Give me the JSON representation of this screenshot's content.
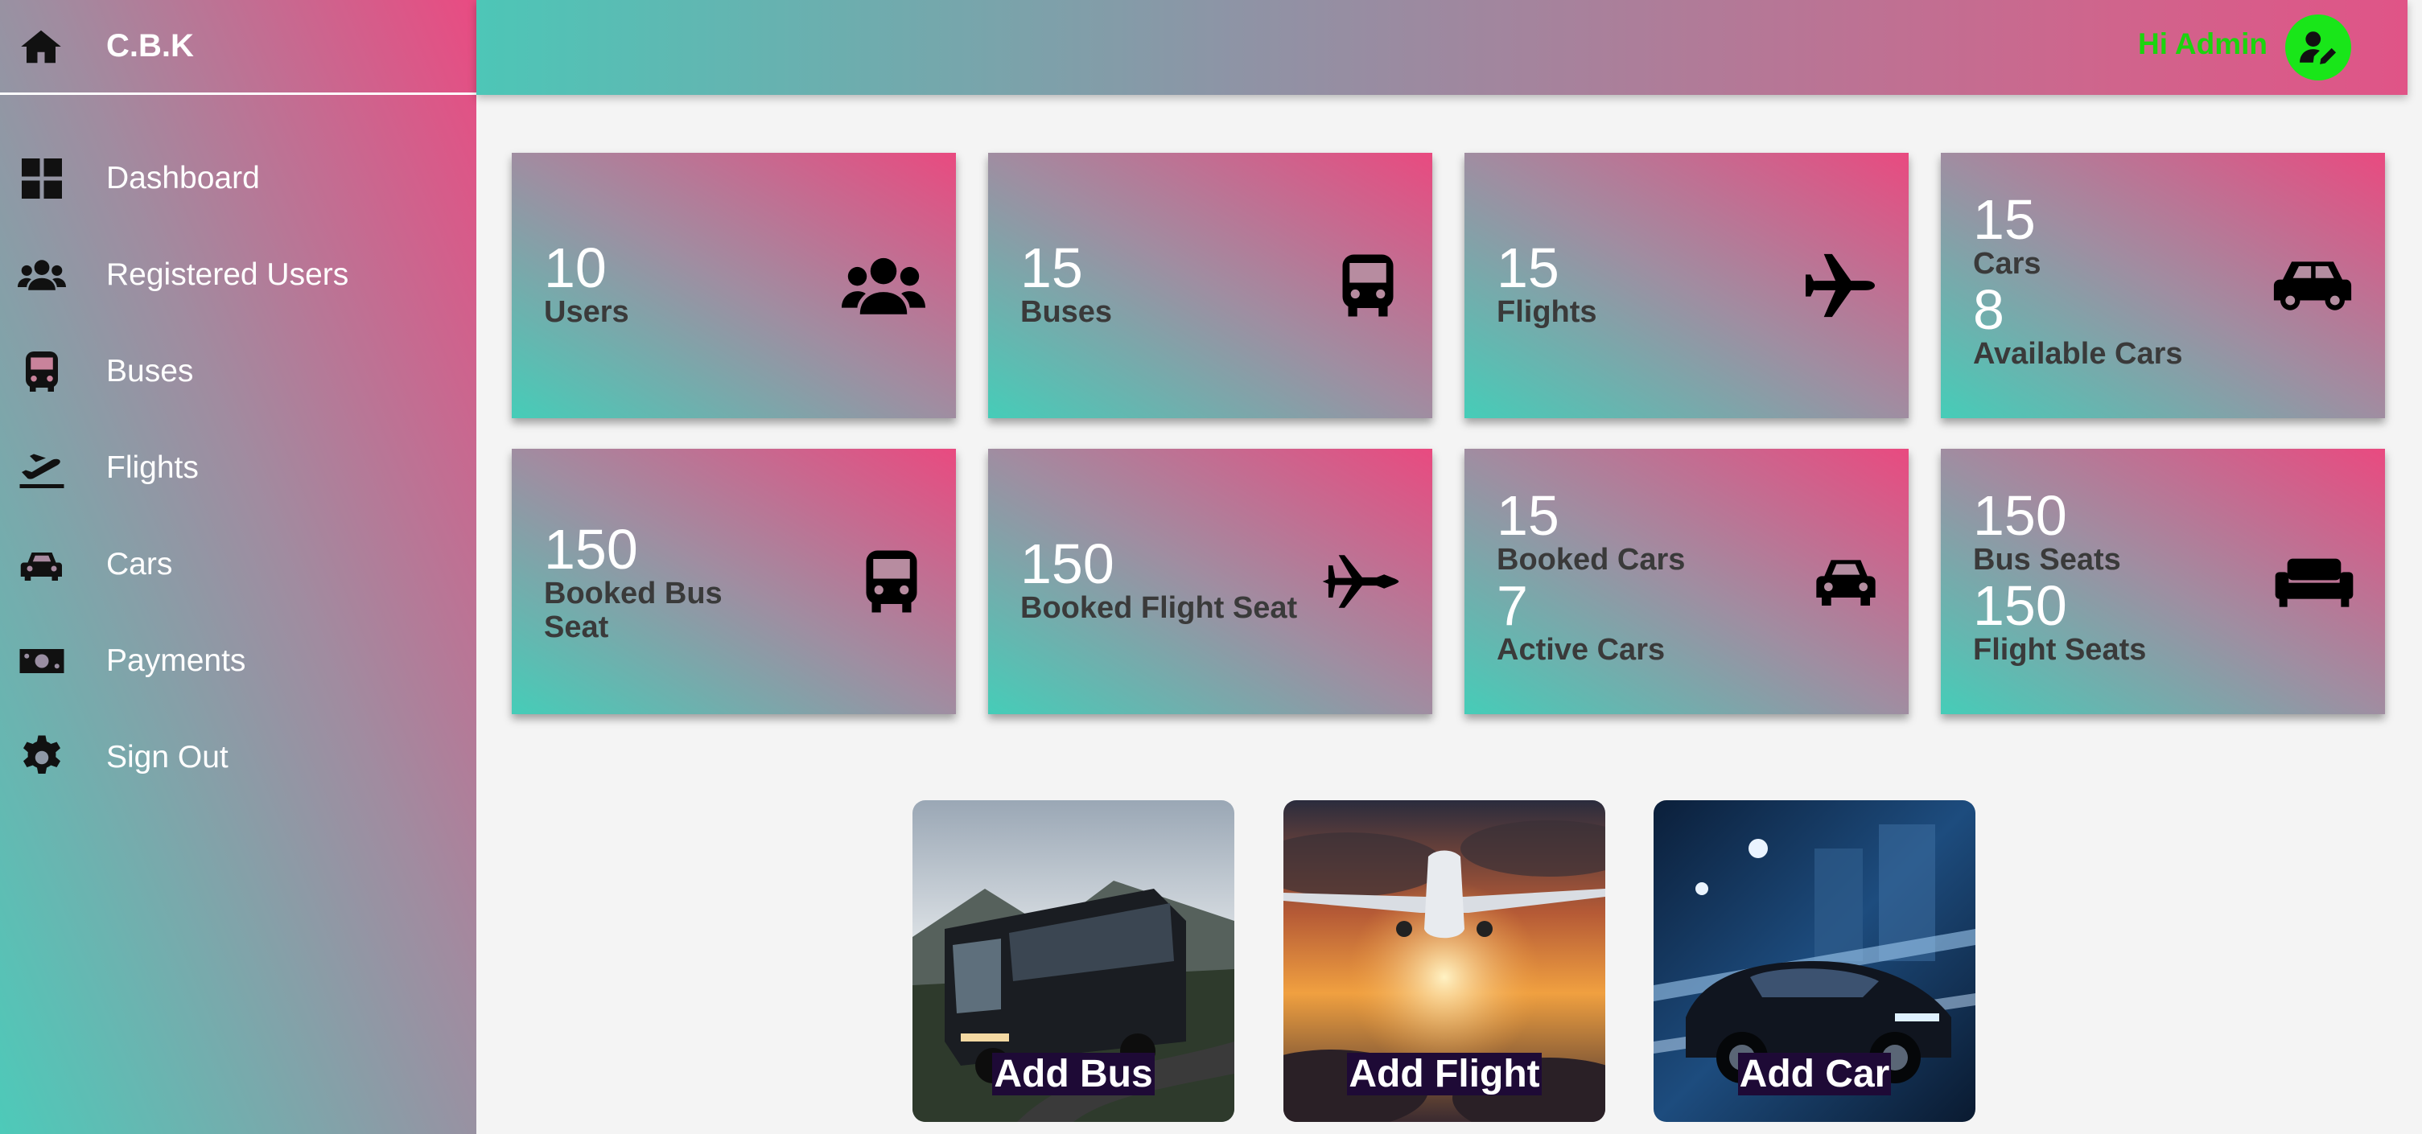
{
  "brand": {
    "name": "C.B.K",
    "icon": "home-icon"
  },
  "sidebar": {
    "items": [
      {
        "label": "Dashboard",
        "icon": "dashboard-icon"
      },
      {
        "label": "Registered Users",
        "icon": "users-icon"
      },
      {
        "label": "Buses",
        "icon": "bus-icon"
      },
      {
        "label": "Flights",
        "icon": "plane-departure-icon"
      },
      {
        "label": "Cars",
        "icon": "car-icon"
      },
      {
        "label": "Payments",
        "icon": "money-bill-icon"
      },
      {
        "label": "Sign Out",
        "icon": "gear-icon"
      }
    ]
  },
  "header": {
    "greeting": "Hi Admin",
    "avatar_icon": "user-edit-icon"
  },
  "cards": {
    "users": {
      "value": "10",
      "label": "Users",
      "icon": "users-icon"
    },
    "buses": {
      "value": "15",
      "label": "Buses",
      "icon": "bus-icon"
    },
    "flights": {
      "value": "15",
      "label": "Flights",
      "icon": "plane-icon"
    },
    "cars": {
      "value": "15",
      "label": "Cars",
      "value2": "8",
      "label2": "Available Cars",
      "icon": "car-icon"
    },
    "booked_bus": {
      "value": "150",
      "label": "Booked Bus",
      "label_line2": "Seat",
      "icon": "bus-icon"
    },
    "booked_flight": {
      "value": "150",
      "label": "Booked Flight Seat",
      "icon": "fighter-jet-icon"
    },
    "booked_cars": {
      "value": "15",
      "label": "Booked Cars",
      "value2": "7",
      "label2": "Active Cars",
      "icon": "car-side-icon"
    },
    "seats": {
      "value": "150",
      "label": "Bus Seats",
      "value2": "150",
      "label2": "Flight Seats",
      "icon": "couch-icon"
    }
  },
  "actions": {
    "add_bus": "Add Bus",
    "add_flight": "Add Flight",
    "add_car": "Add Car"
  },
  "colors": {
    "accent_pink": "#e94b82",
    "accent_teal": "#4dcab9",
    "greeting": "#1bd40e",
    "avatar_bg": "#19e619"
  }
}
